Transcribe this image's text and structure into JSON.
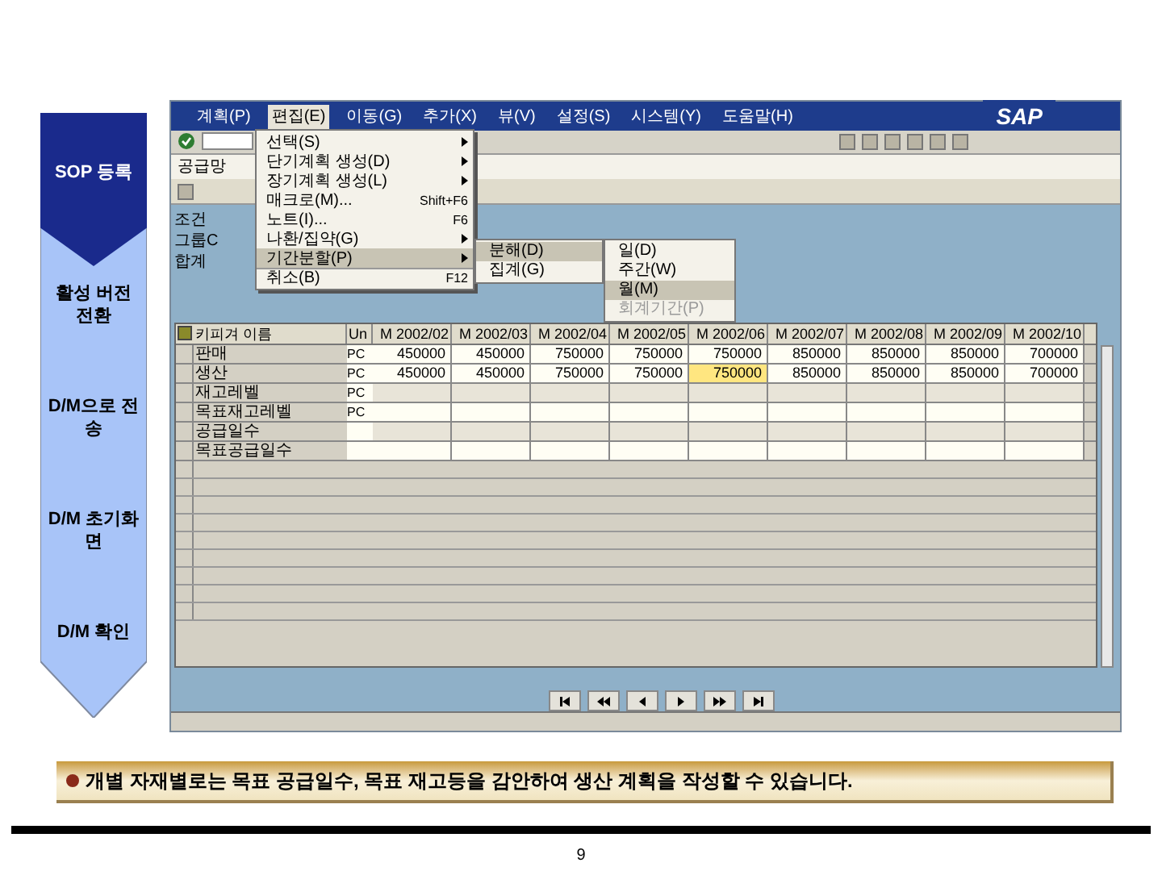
{
  "flow_steps": [
    {
      "label": "SOP 등록",
      "selected": true
    },
    {
      "label": "활성 버전 전환",
      "selected": false
    },
    {
      "label": "D/M으로 전송",
      "selected": false
    },
    {
      "label": "D/M 초기화면",
      "selected": false
    },
    {
      "label": "D/M 확인",
      "selected": false
    }
  ],
  "sap_window": {
    "menu_bar": [
      {
        "label": "계획(P)",
        "selected": false
      },
      {
        "label": "편집(E)",
        "selected": true
      },
      {
        "label": "이동(G)",
        "selected": false
      },
      {
        "label": "추가(X)",
        "selected": false
      },
      {
        "label": "뷰(V)",
        "selected": false
      },
      {
        "label": "설정(S)",
        "selected": false
      },
      {
        "label": "시스템(Y)",
        "selected": false
      },
      {
        "label": "도움말(H)",
        "selected": false
      }
    ],
    "logo": "SAP",
    "screen_title": "공급망",
    "header_labels": [
      "조건",
      "그룹C",
      "합계"
    ],
    "dropdown": [
      {
        "label": "선택(S)",
        "submenu": true,
        "selected": false
      },
      {
        "label": "단기계획 생성(D)",
        "submenu": true,
        "selected": false
      },
      {
        "label": "장기계획 생성(L)",
        "submenu": true,
        "selected": false
      },
      {
        "label": "매크로(M)...",
        "shortcut": "Shift+F6",
        "submenu": false,
        "selected": false
      },
      {
        "label": "노트(I)...",
        "shortcut": "F6",
        "submenu": false,
        "selected": false
      },
      {
        "label": "나환/집약(G)",
        "submenu": true,
        "selected": false
      },
      {
        "label": "기간분할(P)",
        "submenu": true,
        "selected": true
      },
      {
        "label": "취소(B)",
        "shortcut": "F12",
        "submenu": false,
        "selected": false
      }
    ],
    "submenu": [
      {
        "label": "분해(D)",
        "selected": true
      },
      {
        "label": "집계(G)",
        "selected": false
      }
    ],
    "sub_submenu": [
      {
        "label": "일(D)",
        "selected": false,
        "disabled": false
      },
      {
        "label": "주간(W)",
        "selected": false,
        "disabled": false
      },
      {
        "label": "월(M)",
        "selected": true,
        "disabled": false
      },
      {
        "label": "회계기간(P)",
        "selected": false,
        "disabled": true
      }
    ],
    "table": {
      "key_column": "키피겨 이름",
      "unit_column": "Un",
      "columns": [
        "M 2002/02",
        "M 2002/03",
        "M 2002/04",
        "M 2002/05",
        "M 2002/06",
        "M 2002/07",
        "M 2002/08",
        "M 2002/09",
        "M 2002/10"
      ],
      "rows": [
        {
          "name": "판매",
          "unit": "PC",
          "cells": [
            {
              "text": "450000",
              "selected": false
            },
            {
              "text": "450000",
              "selected": false
            },
            {
              "text": "750000",
              "selected": false
            },
            {
              "text": "750000",
              "selected": false
            },
            {
              "text": "750000",
              "selected": false
            },
            {
              "text": "850000",
              "selected": false
            },
            {
              "text": "850000",
              "selected": false
            },
            {
              "text": "850000",
              "selected": false
            },
            {
              "text": "700000",
              "selected": false
            }
          ]
        },
        {
          "name": "생산",
          "unit": "PC",
          "cells": [
            {
              "text": "450000",
              "selected": false
            },
            {
              "text": "450000",
              "selected": false
            },
            {
              "text": "750000",
              "selected": false
            },
            {
              "text": "750000",
              "selected": false
            },
            {
              "text": "750000",
              "selected": true
            },
            {
              "text": "850000",
              "selected": false
            },
            {
              "text": "850000",
              "selected": false
            },
            {
              "text": "850000",
              "selected": false
            },
            {
              "text": "700000",
              "selected": false
            }
          ]
        },
        {
          "name": "재고레벨",
          "unit": "PC",
          "cells": []
        },
        {
          "name": "목표재고레벨",
          "unit": "PC",
          "cells": []
        },
        {
          "name": "공급일수",
          "cells": []
        },
        {
          "name": "목표공급일수",
          "cells": []
        }
      ]
    }
  },
  "caption": "개별 자재별로는 목표 공급일수, 목표 재고등을 감안하여 생산 계획을 작성할 수 있습니다.",
  "page_number": "9"
}
